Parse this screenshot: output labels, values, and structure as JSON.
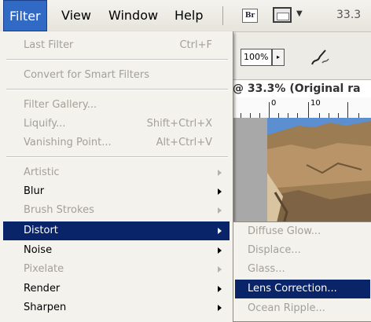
{
  "menubar": {
    "items": [
      "Filter",
      "View",
      "Window",
      "Help"
    ],
    "active": "Filter",
    "bridge_icon_text": "Br",
    "zoom_readout": "33.3"
  },
  "options_bar": {
    "zoom_value": "100%",
    "zoom_arrow": "▸"
  },
  "document": {
    "title": "@ 33.3% (Original ra",
    "ruler_labels": [
      "0",
      "10"
    ]
  },
  "filter_menu": {
    "last_filter": {
      "label": "Last Filter",
      "shortcut": "Ctrl+F"
    },
    "convert": {
      "label": "Convert for Smart Filters"
    },
    "filter_gallery": {
      "label": "Filter Gallery..."
    },
    "liquify": {
      "label": "Liquify...",
      "shortcut": "Shift+Ctrl+X"
    },
    "vanishing_point": {
      "label": "Vanishing Point...",
      "shortcut": "Alt+Ctrl+V"
    },
    "categories": [
      {
        "label": "Artistic",
        "enabled": false
      },
      {
        "label": "Blur",
        "enabled": true
      },
      {
        "label": "Brush Strokes",
        "enabled": false
      },
      {
        "label": "Distort",
        "enabled": true,
        "selected": true
      },
      {
        "label": "Noise",
        "enabled": true
      },
      {
        "label": "Pixelate",
        "enabled": false
      },
      {
        "label": "Render",
        "enabled": true
      },
      {
        "label": "Sharpen",
        "enabled": true
      }
    ]
  },
  "distort_submenu": {
    "items": [
      {
        "label": "Diffuse Glow...",
        "enabled": false
      },
      {
        "label": "Displace...",
        "enabled": false
      },
      {
        "label": "Glass...",
        "enabled": false
      },
      {
        "label": "Lens Correction...",
        "enabled": true,
        "selected": true
      },
      {
        "label": "Ocean Ripple...",
        "enabled": false
      }
    ]
  },
  "colors": {
    "menu_highlight": "#0a246a",
    "menubar_active": "#316ac5",
    "disabled_text": "#a3a098",
    "sky": "#5b8fd0",
    "rock": "#a8865a"
  }
}
